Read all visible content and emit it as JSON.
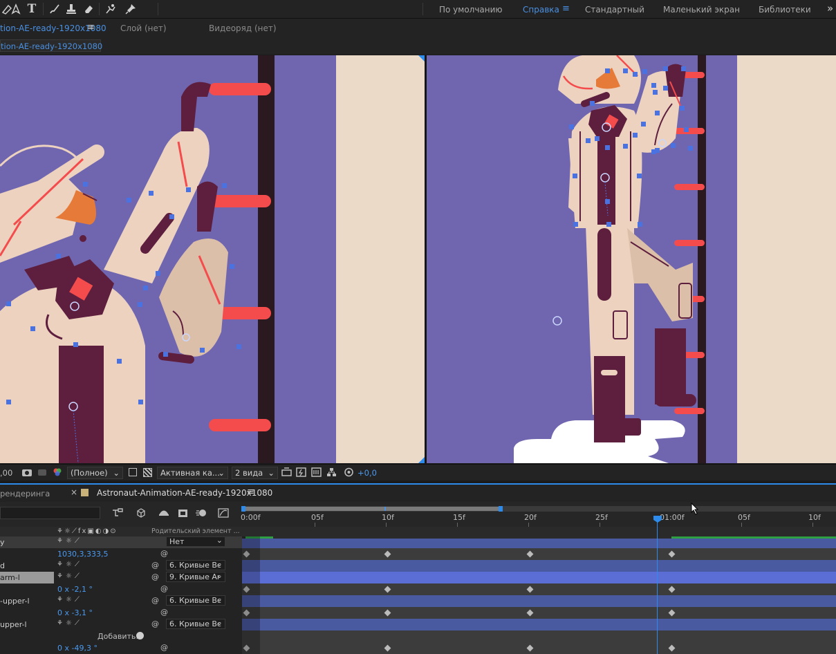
{
  "workspaces": {
    "default": "По умолчанию",
    "help": "Справка",
    "standard": "Стандартный",
    "small_screen": "Маленький экран",
    "libraries": "Библиотеки",
    "more": "»"
  },
  "composition_panel": {
    "active_tab": "tion-AE-ready-1920x1080",
    "layer_tab": "Слой (нет)",
    "footage_tab": "Видеоряд (нет)",
    "breadcrumb": "tion-AE-ready-1920x1080"
  },
  "viewer_controls": {
    "time_fragment": ",00",
    "resolution": "(Полное)",
    "camera": "Активная ка...",
    "views": "2 вида",
    "exposure": "+0,0"
  },
  "timeline": {
    "render_tab": "рендеринга",
    "comp_tab": "Astronaut-Animation-AE-ready-1920x1080",
    "ruler_labels": [
      "0:00f",
      "05f",
      "10f",
      "15f",
      "20f",
      "25f",
      "01:00f",
      "05f",
      "10f"
    ],
    "parent_header": "Родительский элемент ...",
    "add_label": "Добавить:",
    "layers": [
      {
        "name": "y",
        "parent": "Нет"
      },
      {
        "value": "1030,3,333,5"
      },
      {
        "name": "d",
        "parent": "6. Кривые Вс"
      },
      {
        "name": "arm-l",
        "parent": "9. Кривые Ar"
      },
      {
        "value": "0 x -2,1 °"
      },
      {
        "name": "-upper-l",
        "parent": "6. Кривые Вс"
      },
      {
        "value": "0 x -3,1 °"
      },
      {
        "name": "upper-l",
        "parent": "6. Кривые Вс"
      },
      {
        "value": "0 x -49,3 °"
      }
    ]
  },
  "colors": {
    "accent": "#2d8ceb",
    "canvas_bg": "#7066b0",
    "suit": "#ecd2bf",
    "dark": "#5e1f3e",
    "red": "#f44c4c",
    "orange": "#e67a38",
    "handle": "#4a72e0",
    "track_blue": "#4a5aa0"
  }
}
